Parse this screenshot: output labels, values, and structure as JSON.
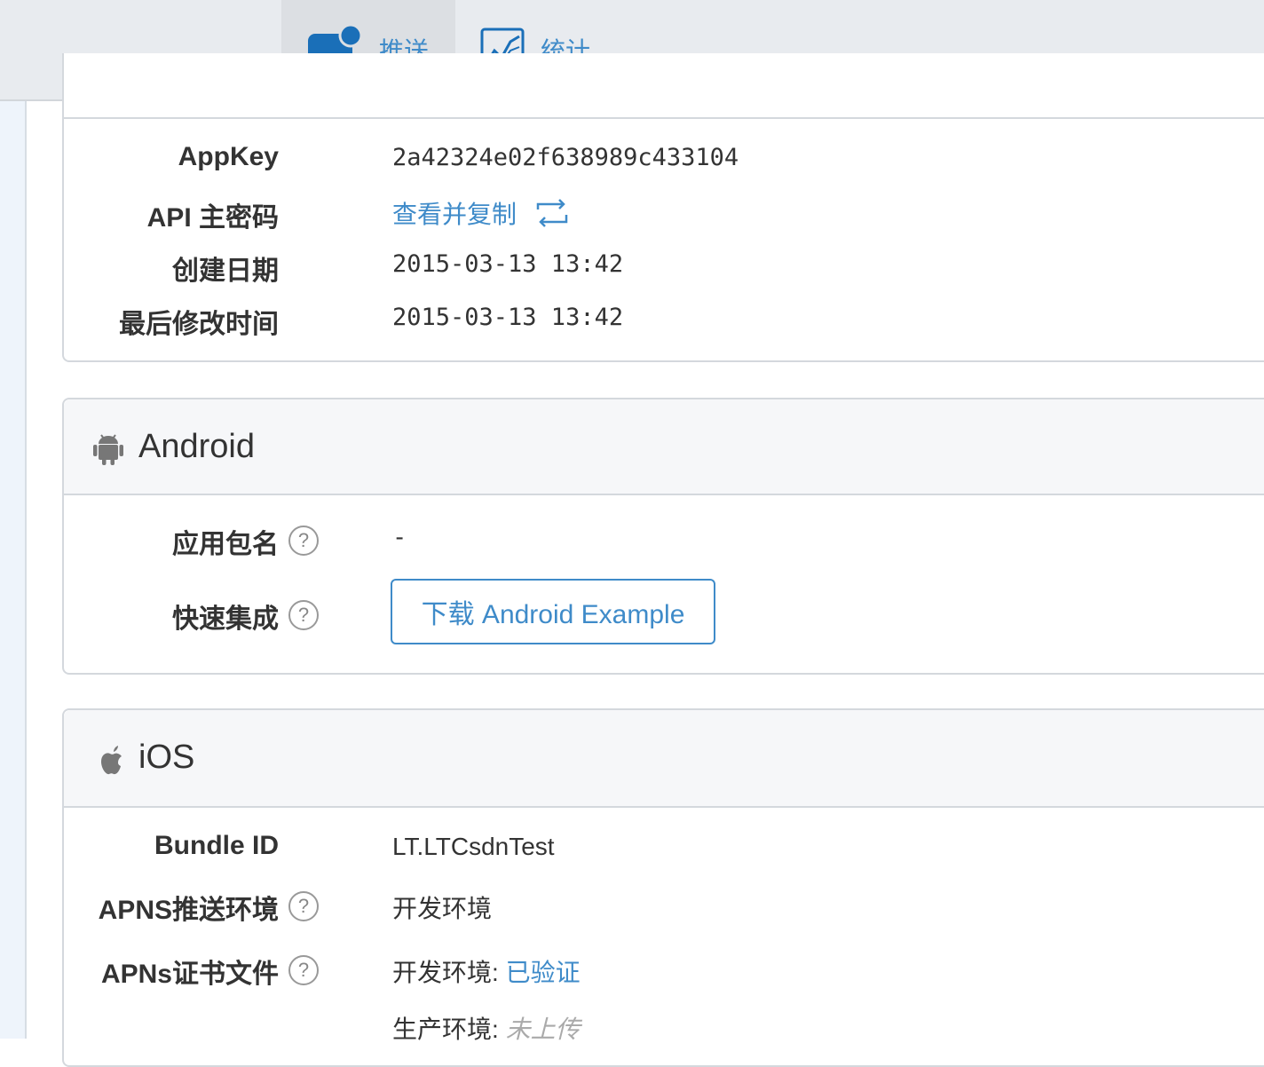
{
  "nav": {
    "tabs": [
      {
        "label": "推送",
        "icon": "chat-bubble-icon",
        "active": true
      },
      {
        "label": "统计",
        "icon": "line-chart-icon",
        "active": false
      }
    ],
    "accent": "#3f8bc9"
  },
  "app_info": {
    "rows": [
      {
        "label": "AppKey",
        "value": "2a42324e02f638989c433104"
      },
      {
        "label": "API 主密码",
        "value": "查看并复制"
      },
      {
        "label": "创建日期",
        "value": "2015-03-13 13:42"
      },
      {
        "label": "最后修改时间",
        "value": "2015-03-13 13:42"
      }
    ]
  },
  "android": {
    "title": "Android",
    "rows": [
      {
        "label": "应用包名",
        "value": "-"
      },
      {
        "label": "快速集成",
        "button": "下载 Android Example"
      }
    ]
  },
  "ios": {
    "title": "iOS",
    "rows": [
      {
        "label": "Bundle ID",
        "value": "LT.LTCsdnTest"
      },
      {
        "label": "APNS推送环境",
        "value": "开发环境"
      },
      {
        "label": "APNs证书文件",
        "dev_label": "开发环境:",
        "dev_status": "已验证",
        "prod_label": "生产环境:",
        "prod_status": "未上传"
      }
    ]
  },
  "help_glyph": "?"
}
